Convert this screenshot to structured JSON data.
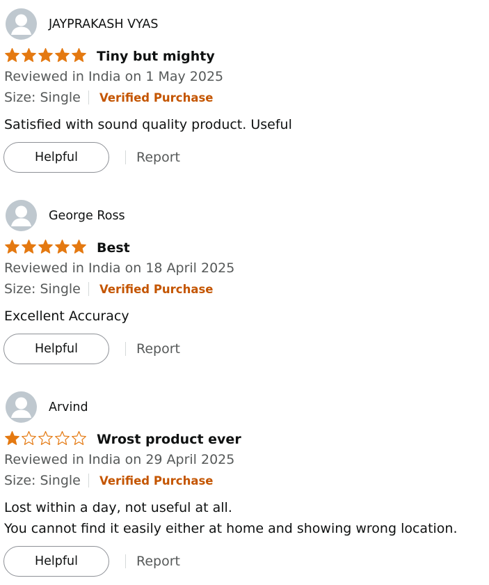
{
  "colors": {
    "star_filled": "#e47911",
    "star_outline": "#e47911",
    "verified": "#c45500",
    "meta_text": "#565959",
    "avatar_bg": "#bfc8cf"
  },
  "helpful_label": "Helpful",
  "report_label": "Report",
  "reviews": [
    {
      "name": "JAYPRAKASH VYAS",
      "rating": 5,
      "title": "Tiny but mighty",
      "date": "Reviewed in India on 1 May 2025",
      "size": "Size: Single",
      "verified": "Verified Purchase",
      "body": [
        "Satisfied with sound quality product. Useful"
      ]
    },
    {
      "name": "George Ross",
      "rating": 5,
      "title": "Best",
      "date": "Reviewed in India on 18 April 2025",
      "size": "Size: Single",
      "verified": "Verified Purchase",
      "body": [
        "Excellent Accuracy"
      ]
    },
    {
      "name": "Arvind",
      "rating": 1,
      "title": "Wrost product ever",
      "date": "Reviewed in India on 29 April 2025",
      "size": "Size: Single",
      "verified": "Verified Purchase",
      "body": [
        "Lost within a day, not useful at all.",
        "You cannot find it easily either at home and showing wrong location."
      ]
    }
  ]
}
